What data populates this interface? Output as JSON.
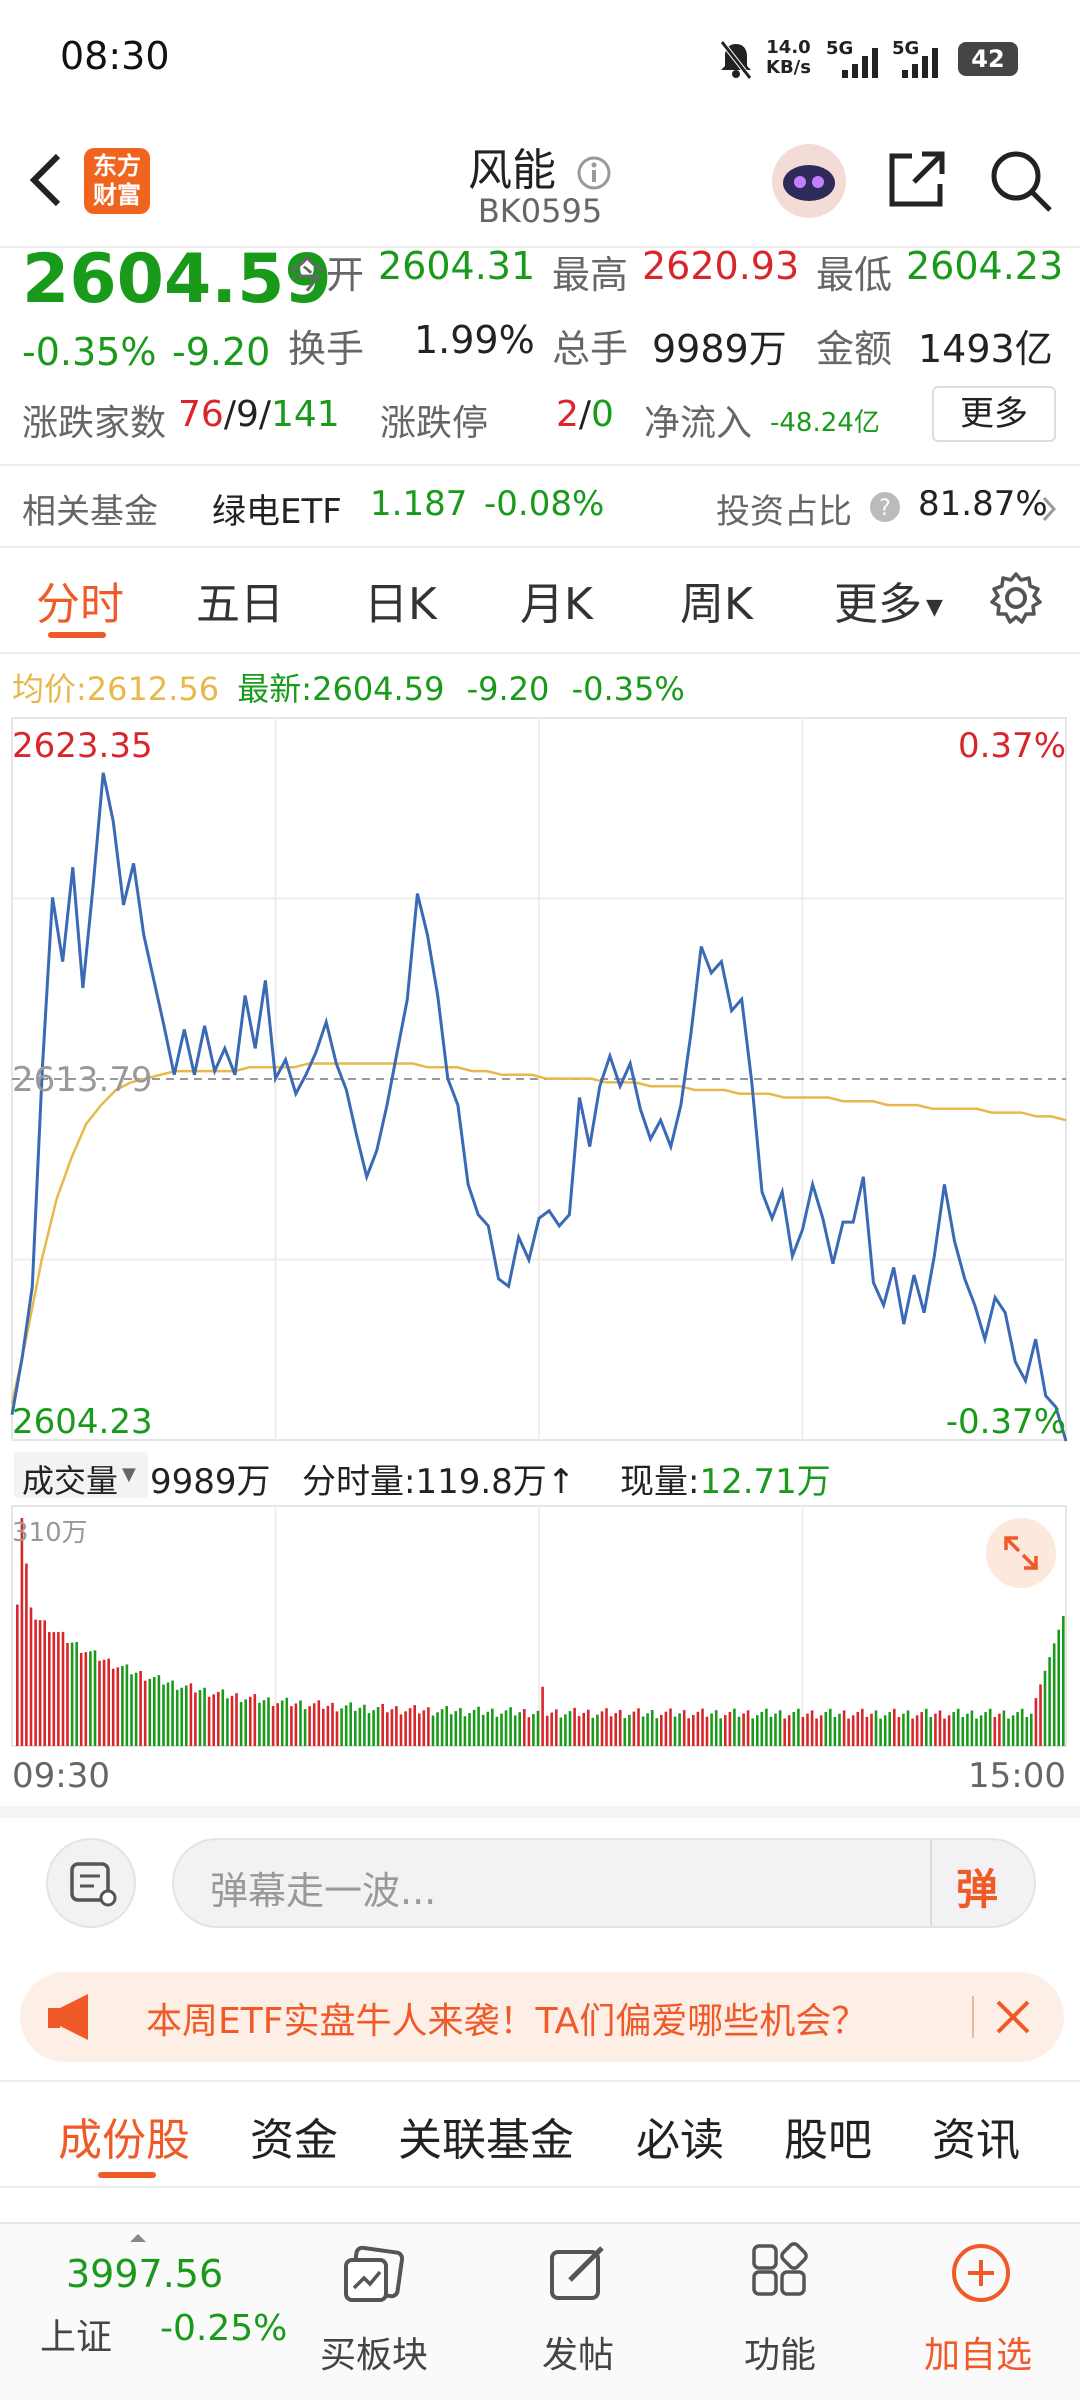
{
  "status_bar": {
    "time": "08:30",
    "net_speed_top": "14.0",
    "net_speed_unit": "KB/s",
    "sig1": "5G",
    "sig2": "5G",
    "battery": "42"
  },
  "header": {
    "title": "风能",
    "code": "BK0595",
    "logo_line1": "东方",
    "logo_line2": "财富"
  },
  "quote": {
    "price": "2604.59",
    "change_pct": "-0.35%",
    "change": "-9.20",
    "open_label": "今开",
    "open": "2604.31",
    "high_label": "最高",
    "high": "2620.93",
    "low_label": "最低",
    "low": "2604.23",
    "turnover_label": "换手",
    "turnover": "1.99%",
    "volume_label": "总手",
    "volume": "9989万",
    "amount_label": "金额",
    "amount": "1493亿",
    "breadth_label": "涨跌家数",
    "breadth_up": "76",
    "breadth_flat": "9",
    "breadth_down": "141",
    "slash": "/",
    "limit_label": "涨跌停",
    "limit_up": "2",
    "limit_down": "0",
    "netflow_label": "净流入",
    "netflow": "-48.24亿",
    "more_button": "更多"
  },
  "fund_row": {
    "label": "相关基金",
    "fund_name": "绿电ETF",
    "fund_price": "1.187",
    "fund_change": "-0.08%",
    "ratio_label": "投资占比",
    "ratio": "81.87%"
  },
  "chart_tabs": [
    "分时",
    "五日",
    "日K",
    "月K",
    "周K",
    "更多"
  ],
  "chart_info": {
    "avg_label": "均价:",
    "avg": "2612.56",
    "latest_label": "最新:",
    "latest": "2604.59",
    "latest_change": "-9.20",
    "latest_pct": "-0.35%"
  },
  "chart_data": {
    "type": "line",
    "y_top": "2623.35",
    "y_mid": "2613.79",
    "y_bottom": "2604.23",
    "pct_top": "0.37%",
    "pct_bottom": "-0.37%",
    "ylim": [
      2604.23,
      2623.35
    ],
    "x_start": "09:30",
    "x_end": "15:00",
    "series": [
      {
        "name": "最新",
        "values": [
          2604.9,
          2606.4,
          2608.3,
          2614.1,
          2618.6,
          2616.9,
          2619.4,
          2616.2,
          2618.9,
          2621.9,
          2620.6,
          2618.4,
          2619.5,
          2617.6,
          2616.4,
          2615.2,
          2613.9,
          2615.1,
          2613.9,
          2615.2,
          2614.0,
          2614.6,
          2613.9,
          2616.0,
          2614.6,
          2616.4,
          2613.8,
          2614.3,
          2613.4,
          2613.9,
          2614.5,
          2615.3,
          2614.2,
          2613.5,
          2612.3,
          2611.2,
          2611.9,
          2613.1,
          2614.5,
          2615.9,
          2618.7,
          2617.6,
          2616.0,
          2613.8,
          2613.1,
          2611.0,
          2610.2,
          2609.9,
          2608.5,
          2608.3,
          2609.6,
          2609.0,
          2610.1,
          2610.3,
          2609.9,
          2610.2,
          2613.3,
          2612.0,
          2613.6,
          2614.4,
          2613.6,
          2614.2,
          2613.0,
          2612.2,
          2612.7,
          2612.0,
          2613.1,
          2615.0,
          2617.3,
          2616.6,
          2616.9,
          2615.6,
          2615.9,
          2613.7,
          2610.8,
          2610.1,
          2610.8,
          2609.1,
          2609.8,
          2611.0,
          2610.1,
          2608.9,
          2610.0,
          2610.0,
          2611.2,
          2608.4,
          2607.8,
          2608.8,
          2607.3,
          2608.6,
          2607.6,
          2609.1,
          2611.0,
          2609.5,
          2608.5,
          2607.8,
          2606.9,
          2608.0,
          2607.6,
          2606.3,
          2605.8,
          2606.9,
          2605.4,
          2605.1,
          2604.2
        ]
      },
      {
        "name": "均价",
        "values": [
          2605.2,
          2607.0,
          2609.0,
          2610.6,
          2611.7,
          2612.6,
          2613.1,
          2613.5,
          2613.7,
          2613.8,
          2613.9,
          2614.0,
          2614.0,
          2614.0,
          2614.0,
          2614.0,
          2614.1,
          2614.1,
          2614.1,
          2614.1,
          2614.2,
          2614.2,
          2614.2,
          2614.2,
          2614.2,
          2614.2,
          2614.2,
          2614.2,
          2614.1,
          2614.1,
          2614.1,
          2614.0,
          2614.0,
          2613.9,
          2613.9,
          2613.9,
          2613.8,
          2613.8,
          2613.8,
          2613.8,
          2613.7,
          2613.7,
          2613.7,
          2613.6,
          2613.6,
          2613.6,
          2613.5,
          2613.5,
          2613.5,
          2613.4,
          2613.4,
          2613.4,
          2613.3,
          2613.3,
          2613.3,
          2613.3,
          2613.2,
          2613.2,
          2613.2,
          2613.1,
          2613.1,
          2613.1,
          2613.0,
          2613.0,
          2613.0,
          2613.0,
          2612.9,
          2612.9,
          2612.9,
          2612.8,
          2612.8,
          2612.7
        ]
      }
    ],
    "volume_max_label": "310万"
  },
  "volume_info": {
    "label": "成交量",
    "total": "9989万",
    "min_vol_label": "分时量:",
    "min_vol": "119.8万",
    "arrow": "↑",
    "cur_vol_label": "现量:",
    "cur_vol": "12.71万"
  },
  "danmu": {
    "placeholder": "弹幕走一波...",
    "send_label": "弹"
  },
  "banner": {
    "text": "本周ETF实盘牛人来袭！TA们偏爱哪些机会？"
  },
  "section_tabs": [
    "成份股",
    "资金",
    "关联基金",
    "必读",
    "股吧",
    "资讯"
  ],
  "bottom_nav": {
    "index_value": "3997.56",
    "index_name": "上证",
    "index_change": "-0.25%",
    "items": [
      "买板块",
      "发帖",
      "功能",
      "加自选"
    ]
  },
  "colors": {
    "up": "#d8262b",
    "down": "#1a9a1a",
    "accent": "#f05a28",
    "price_line": "#3a6ab5",
    "avg_line": "#e8b84a"
  }
}
